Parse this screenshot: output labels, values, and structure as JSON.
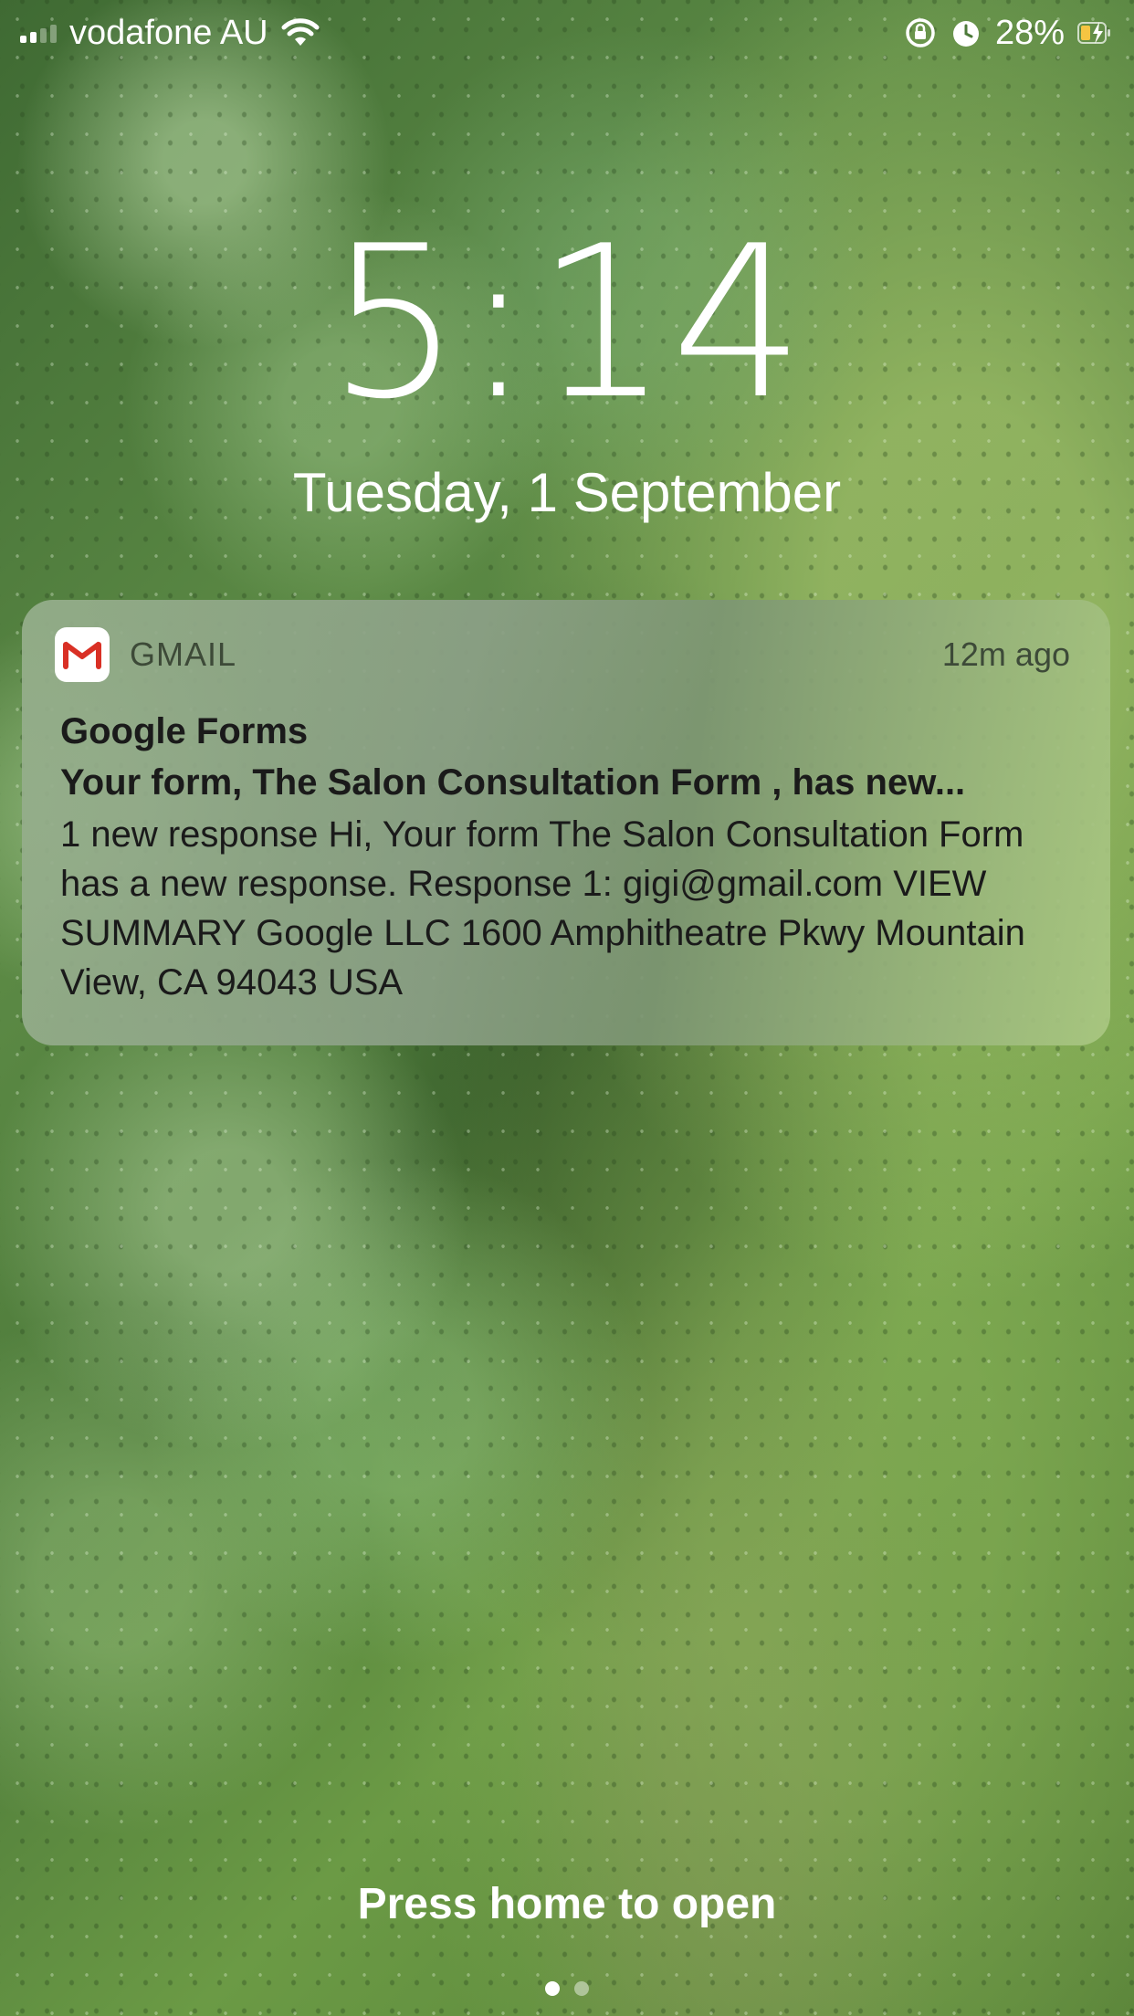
{
  "status_bar": {
    "carrier": "vodafone AU",
    "battery_percent": "28%",
    "signal_bars_filled": 2,
    "signal_bars_total": 4,
    "icons": [
      "signal-icon",
      "wifi-icon",
      "orientation-lock-icon",
      "alarm-icon",
      "battery-charging-icon"
    ],
    "battery_color": "#f5c542"
  },
  "lock_screen": {
    "time": "5:14",
    "date": "Tuesday, 1 September"
  },
  "notification": {
    "app_name": "GMAIL",
    "app_icon": "gmail-icon",
    "time_ago": "12m ago",
    "sender": "Google Forms",
    "subject": "Your form, The Salon Consultation Form , has new...",
    "preview": "1 new response Hi, Your form The Salon Consultation Form has a new response. Response 1: gigi@gmail.com VIEW SUMMARY Google LLC 1600 Amphitheatre Pkwy Mountain View, CA 94043 USA"
  },
  "bottom": {
    "hint": "Press home to open",
    "pages_total": 2,
    "page_active": 1
  },
  "colors": {
    "gmail_red": "#d93025"
  }
}
